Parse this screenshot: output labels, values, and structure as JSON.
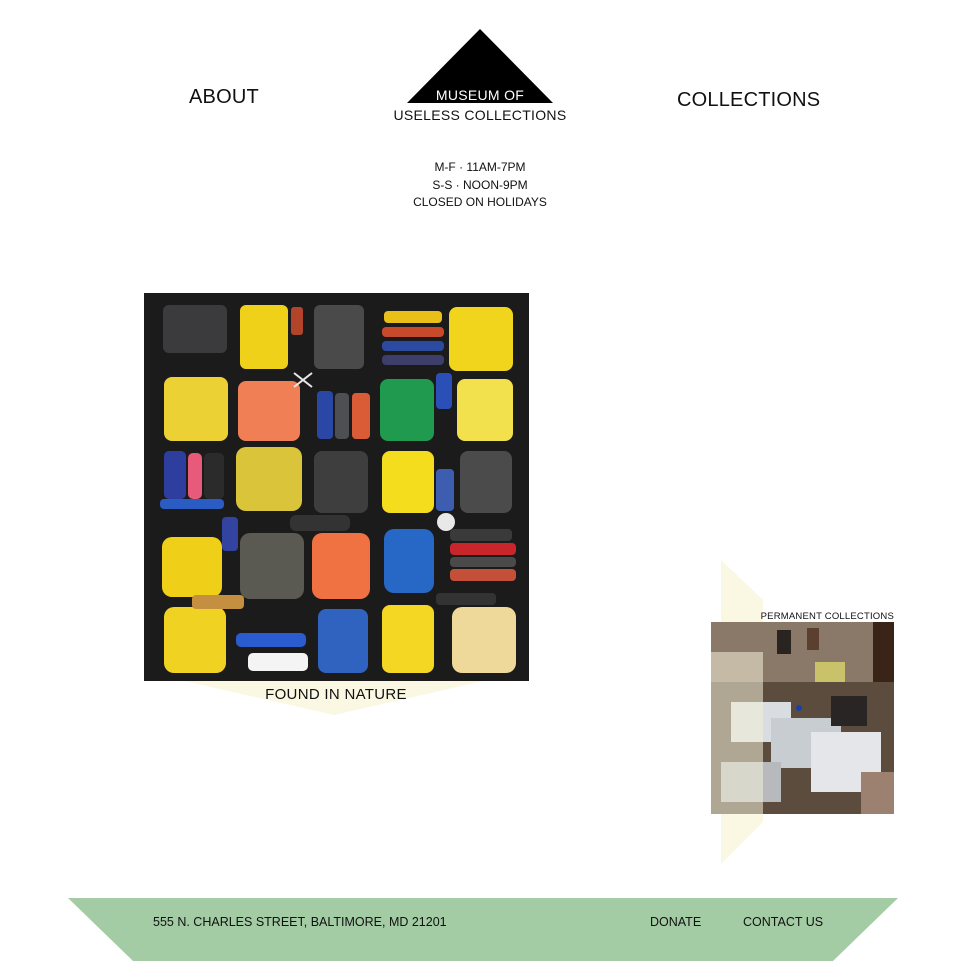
{
  "header": {
    "about": "ABOUT",
    "collections": "COLLECTIONS",
    "logo": {
      "line1": "MUSEUM OF",
      "line2": "USELESS COLLECTIONS"
    }
  },
  "hours": [
    "M-F · 11AM-7PM",
    "S-S · NOON-9PM",
    "CLOSED ON HOLIDAYS"
  ],
  "featured": {
    "caption": "FOUND IN NATURE"
  },
  "permanent": {
    "label": "PERMANENT COLLECTIONS"
  },
  "footer": {
    "address": "555 N. CHARLES STREET, BALTIMORE, MD 21201",
    "donate": "DONATE",
    "contact": "CONTACT US"
  },
  "colors": {
    "footer_band": "#a3cca4",
    "accent_cream": "#faf8e2",
    "text": "#111111"
  }
}
